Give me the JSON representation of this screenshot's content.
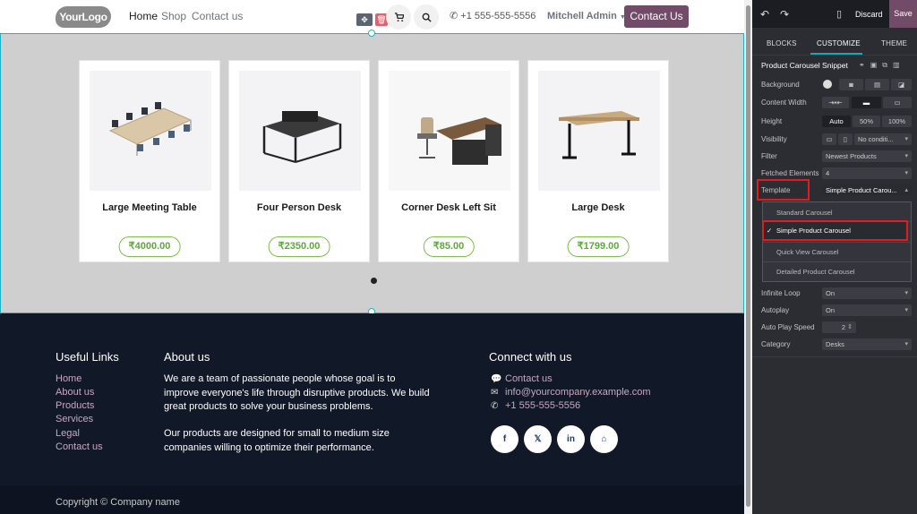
{
  "nav": {
    "logo": "YourLogo",
    "links": [
      "Home",
      "Shop",
      "Contact us"
    ],
    "phone": "+1 555-555-5556",
    "user": "Mitchell Admin",
    "contact_button": "Contact Us"
  },
  "carousel": {
    "products": [
      {
        "name": "Large Meeting Table",
        "price": "₹4000.00"
      },
      {
        "name": "Four Person Desk",
        "price": "₹2350.00"
      },
      {
        "name": "Corner Desk Left Sit",
        "price": "₹85.00"
      },
      {
        "name": "Large Desk",
        "price": "₹1799.00"
      }
    ]
  },
  "footer": {
    "useful_links_title": "Useful Links",
    "useful_links": [
      "Home",
      "About us",
      "Products",
      "Services",
      "Legal",
      "Contact us"
    ],
    "about_title": "About us",
    "about_p1": "We are a team of passionate people whose goal is to improve everyone's life through disruptive products. We build great products to solve your business problems.",
    "about_p2": "Our products are designed for small to medium size companies willing to optimize their performance.",
    "connect_title": "Connect with us",
    "contact_link": "Contact us",
    "email": "info@yourcompany.example.com",
    "phone": "+1 555-555-5556",
    "social": [
      "f",
      "𝕏",
      "in",
      "⌂"
    ],
    "copyright": "Copyright © Company name"
  },
  "panel": {
    "discard": "Discard",
    "save": "Save",
    "tabs": [
      "BLOCKS",
      "CUSTOMIZE",
      "THEME"
    ],
    "snippet_title": "Product Carousel Snippet",
    "rows": {
      "background": "Background",
      "content_width": "Content Width",
      "height": "Height",
      "height_options": [
        "Auto",
        "50%",
        "100%"
      ],
      "visibility": "Visibility",
      "visibility_value": "No conditi...",
      "filter": "Filter",
      "filter_value": "Newest Products",
      "fetched": "Fetched Elements",
      "fetched_value": "4",
      "template": "Template",
      "template_value": "Simple Product Carou...",
      "infinite_loop": "Infinite Loop",
      "infinite_loop_value": "On",
      "autoplay": "Autoplay",
      "autoplay_value": "On",
      "autoplay_speed": "Auto Play Speed",
      "autoplay_speed_value": "2",
      "category": "Category",
      "category_value": "Desks"
    },
    "template_options": [
      "Standard Carousel",
      "Simple Product Carousel",
      "Quick View Carousel",
      "Detailed Product Carousel"
    ],
    "selected_template": "Simple Product Carousel"
  }
}
